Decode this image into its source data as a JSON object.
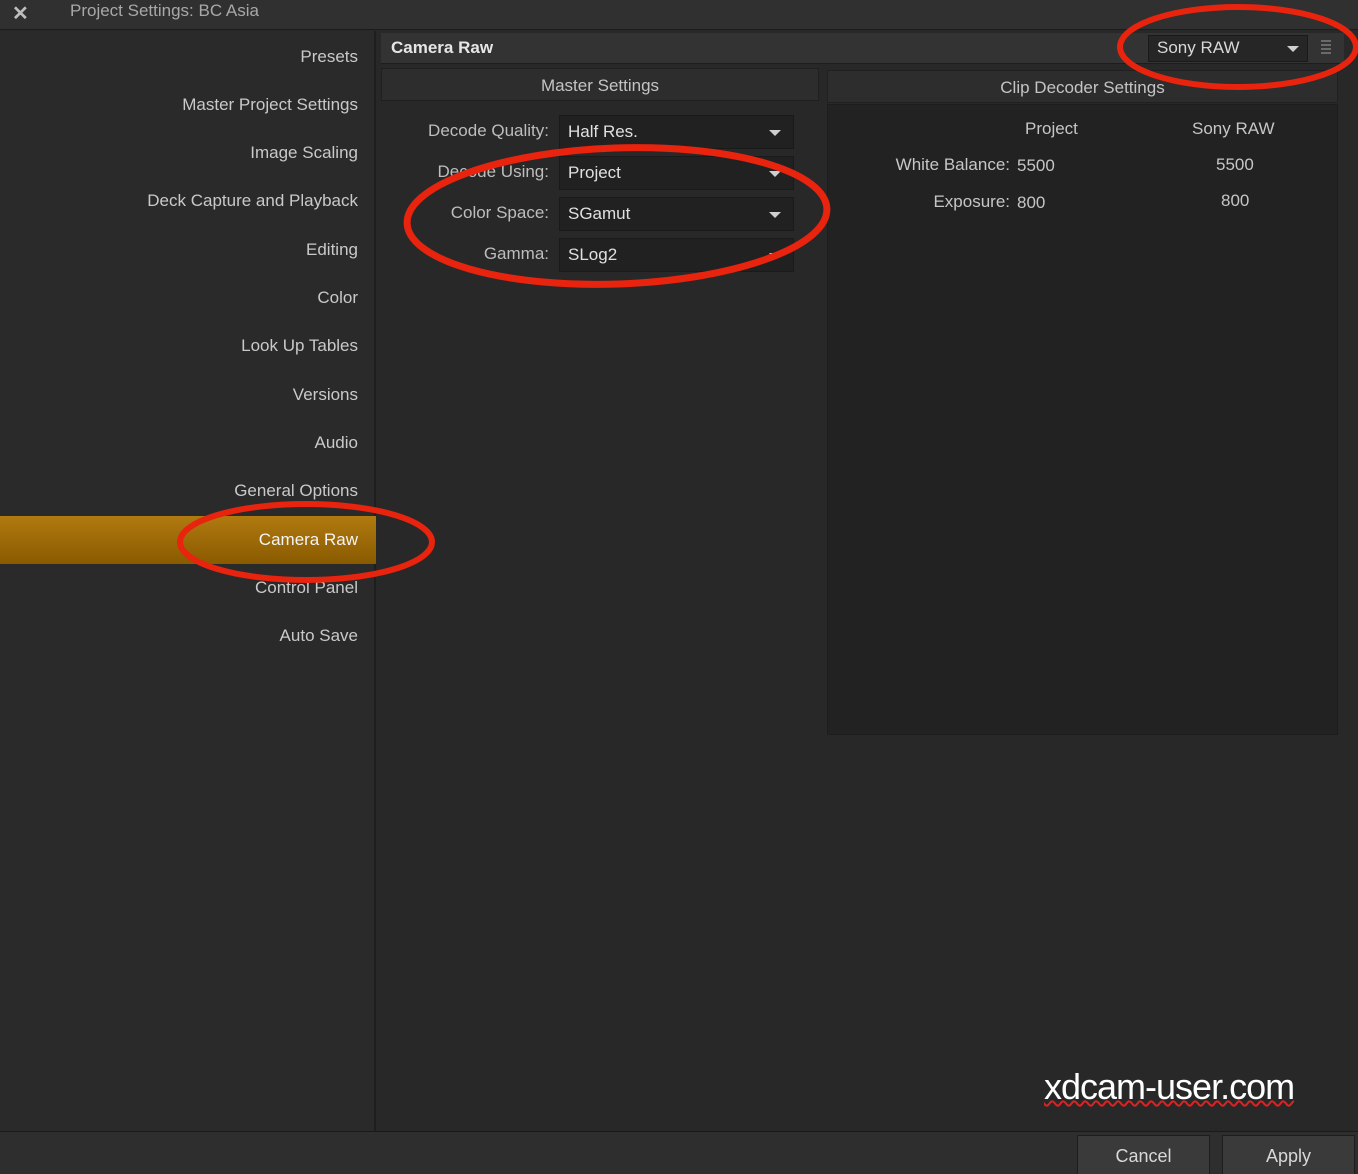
{
  "window": {
    "close_icon": "close-icon",
    "title": "Project Settings:  BC Asia"
  },
  "sidebar": {
    "items": [
      {
        "label": "Presets"
      },
      {
        "label": "Master Project Settings"
      },
      {
        "label": "Image Scaling"
      },
      {
        "label": "Deck Capture and Playback"
      },
      {
        "label": "Editing"
      },
      {
        "label": "Color"
      },
      {
        "label": "Look Up Tables"
      },
      {
        "label": "Versions"
      },
      {
        "label": "Audio"
      },
      {
        "label": "General Options"
      },
      {
        "label": "Camera Raw",
        "active": true
      },
      {
        "label": "Control Panel"
      },
      {
        "label": "Auto Save"
      }
    ]
  },
  "header": {
    "section_title": "Camera Raw",
    "raw_format": "Sony RAW"
  },
  "master": {
    "title": "Master Settings",
    "fields": [
      {
        "label": "Decode Quality:",
        "value": "Half Res."
      },
      {
        "label": "Decode Using:",
        "value": "Project"
      },
      {
        "label": "Color Space:",
        "value": "SGamut"
      },
      {
        "label": "Gamma:",
        "value": "SLog2"
      }
    ]
  },
  "clip": {
    "title": "Clip Decoder Settings",
    "col_project": "Project",
    "col_sony": "Sony RAW",
    "rows": [
      {
        "label": "White Balance:",
        "project": "5500",
        "sony": "5500"
      },
      {
        "label": "Exposure:",
        "project": "800",
        "sony": "800"
      }
    ]
  },
  "footer": {
    "cancel_label": "Cancel",
    "apply_label": "Apply"
  },
  "watermark": "xdcam-user.com",
  "colors": {
    "active_item": "#9a6a05",
    "annotation": "#e8230e"
  }
}
